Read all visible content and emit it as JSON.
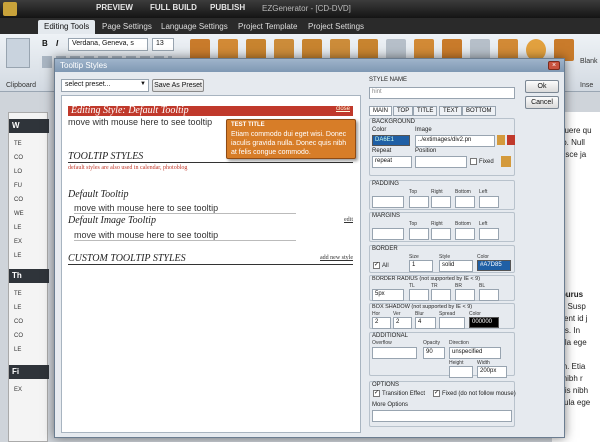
{
  "app": {
    "title": "EZGenerator - [CD-DVD]",
    "menu": [
      "PREVIEW",
      "FULL BUILD",
      "PUBLISH"
    ],
    "tabs": [
      "Editing Tools",
      "Page Settings",
      "Language Settings",
      "Project Template",
      "Project Settings"
    ],
    "active_tab": 0
  },
  "ribbon": {
    "font_name": "Verdana, Geneva, s",
    "font_size": "13",
    "bold": "B",
    "italic": "I",
    "group_label_clipboard": "Clipboard",
    "group_label_blank": "Blank",
    "group_label_insert": "Inse"
  },
  "bg": {
    "left_heads": [
      "W",
      "Th",
      "Fi"
    ],
    "left_items": [
      "TE",
      "CO",
      "LO",
      "FU",
      "CO",
      "WE",
      "LE",
      "EX",
      "LE",
      "TE",
      "LE",
      "CO",
      "CO",
      "LE",
      "EX"
    ],
    "right_lines": [
      "osuere qu",
      "leo. Null",
      "Fusce ja",
      "t purus",
      "ro. Susp",
      "ssent id j",
      "eos. In",
      "gula ege",
      "um. Etia",
      "a nibh r",
      "quis nibh",
      "ligula ege"
    ]
  },
  "dialog": {
    "title": "Tooltip Styles",
    "preset_placeholder": "select preset...",
    "save_as_preset": "Save As Preset",
    "editing_style": "Editing Style: Default Tooltip",
    "close_link": "close",
    "move_link": "move with mouse here to see tooltip",
    "tooltip_styles_heading": "TOOLTIP STYLES",
    "tooltip_styles_sub": "default styles are also used in calendar, photoblog",
    "default_tooltip": "Default Tooltip",
    "default_image_tooltip": "Default Image Tooltip",
    "edit_link": "edit",
    "custom_heading": "CUSTOM TOOLTIP STYLES",
    "add_new_style": "add new style",
    "tooltip_preview": {
      "title": "TEST TITLE",
      "body": "Etiam commodo dui eget wisi. Donec iaculis gravida nulla. Donec quis nibh at felis congue commodo."
    },
    "ok": "Ok",
    "cancel": "Cancel"
  },
  "props": {
    "style_name_label": "STYLE NAME",
    "style_name_value": "hint",
    "tabs": [
      "MAIN",
      "TOP",
      "TITLE",
      "TEXT",
      "BOTTOM"
    ],
    "active_tab": 0,
    "background_label": "BACKGROUND",
    "color_label": "Color",
    "color_value": "DA6E1",
    "image_label": "Image",
    "image_value": "../extimages/div2.pn",
    "repeat_label": "Repeat",
    "repeat_value": "repeat",
    "position_label": "Position",
    "fixed_label": "Fixed",
    "padding_label": "PADDING",
    "margins_label": "MARGINS",
    "side_headers": [
      "Top",
      "Right",
      "Bottom",
      "Left"
    ],
    "border_label": "BORDER",
    "all_label": "All",
    "size_label": "Size",
    "size_value": "1",
    "style_label": "Style",
    "style_value": "solid",
    "border_color_label": "Color",
    "border_color_value": "#A7D85",
    "radius_label": "BORDER RADIUS (not supported by IE < 9)",
    "radius_headers": [
      "TL",
      "TR",
      "BR",
      "BL"
    ],
    "radius_value": "5px",
    "shadow_label": "BOX SHADOW (not supported by IE < 9)",
    "shadow_headers": [
      "Hor",
      "Ver",
      "Blur",
      "Spread",
      "Color"
    ],
    "shadow_hor": "2",
    "shadow_ver": "2",
    "shadow_blur": "4",
    "shadow_color": "000000",
    "additional_label": "ADDITIONAL",
    "overflow_label": "Overflow",
    "opacity_label": "Opacity",
    "opacity_value": "90",
    "direction_label": "Direction",
    "direction_value": "unspecified",
    "height_label": "Height",
    "width_label": "Width",
    "width_value": "200px",
    "options_label": "OPTIONS",
    "transition_label": "Transition Effect",
    "fixed_mouse_label": "Fixed (do not follow mouse)",
    "more_options_label": "More Options"
  },
  "colors": {
    "accent_red": "#c0392b",
    "tooltip_orange": "#d77d28",
    "swatch_blue": "#1f5fa5"
  }
}
